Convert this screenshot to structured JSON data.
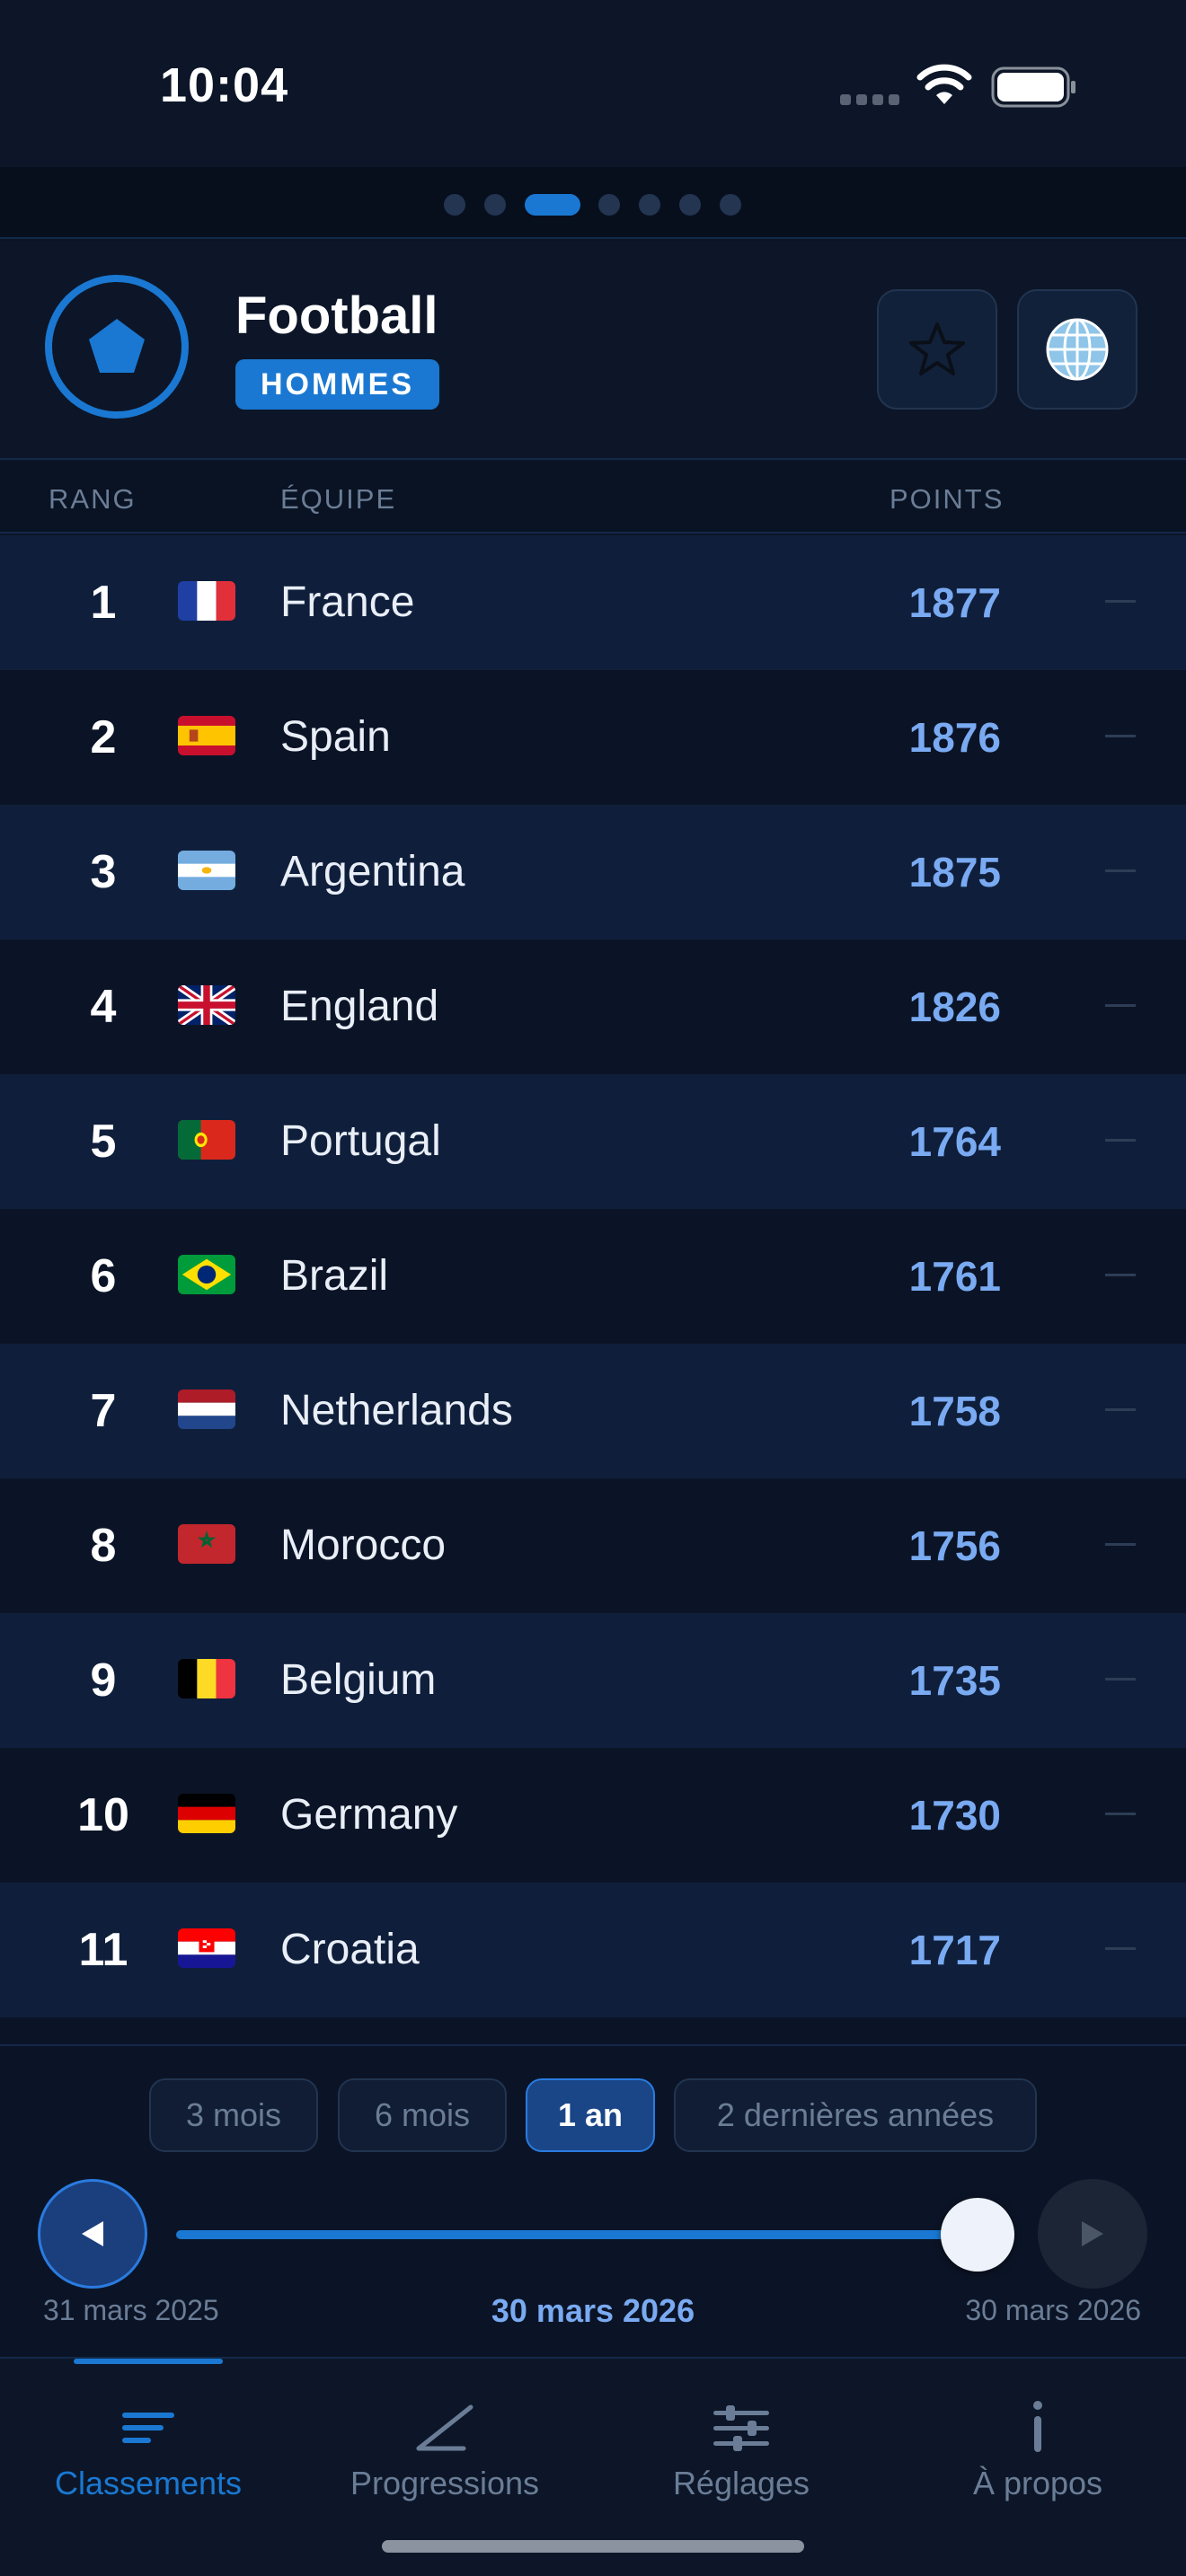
{
  "status_bar": {
    "time": "10:04"
  },
  "pager": {
    "count": 8,
    "active_index": 2
  },
  "header": {
    "sport": "Football",
    "gender": "HOMMES",
    "favorite_icon": "star-outline-icon",
    "language_icon": "globe-icon",
    "badge_icon": "pentagon-icon"
  },
  "table": {
    "columns": {
      "rank": "RANG",
      "team": "ÉQUIPE",
      "points": "POINTS"
    },
    "rows": [
      {
        "rank": "1",
        "flag": "france",
        "team": "France",
        "points": "1877",
        "trend": "—"
      },
      {
        "rank": "2",
        "flag": "spain",
        "team": "Spain",
        "points": "1876",
        "trend": "—"
      },
      {
        "rank": "3",
        "flag": "argentina",
        "team": "Argentina",
        "points": "1875",
        "trend": "—"
      },
      {
        "rank": "4",
        "flag": "england",
        "team": "England",
        "points": "1826",
        "trend": "—"
      },
      {
        "rank": "5",
        "flag": "portugal",
        "team": "Portugal",
        "points": "1764",
        "trend": "—"
      },
      {
        "rank": "6",
        "flag": "brazil",
        "team": "Brazil",
        "points": "1761",
        "trend": "—"
      },
      {
        "rank": "7",
        "flag": "netherlands",
        "team": "Netherlands",
        "points": "1758",
        "trend": "—"
      },
      {
        "rank": "8",
        "flag": "morocco",
        "team": "Morocco",
        "points": "1756",
        "trend": "—"
      },
      {
        "rank": "9",
        "flag": "belgium",
        "team": "Belgium",
        "points": "1735",
        "trend": "—"
      },
      {
        "rank": "10",
        "flag": "germany",
        "team": "Germany",
        "points": "1730",
        "trend": "—"
      },
      {
        "rank": "11",
        "flag": "croatia",
        "team": "Croatia",
        "points": "1717",
        "trend": "—"
      }
    ]
  },
  "range": {
    "options": [
      "3 mois",
      "6 mois",
      "1 an",
      "2 dernières années"
    ],
    "selected": "1 an"
  },
  "timeline": {
    "start": "31 mars 2025",
    "current": "30 mars 2026",
    "end": "30 mars 2026",
    "position": 1.0,
    "prev_icon": "triangle-left-icon",
    "next_icon": "triangle-right-icon"
  },
  "tabs": [
    {
      "label": "Classements",
      "icon": "list-icon",
      "active": true
    },
    {
      "label": "Progressions",
      "icon": "trend-line-icon",
      "active": false
    },
    {
      "label": "Réglages",
      "icon": "sliders-icon",
      "active": false
    },
    {
      "label": "À propos",
      "icon": "info-icon",
      "active": false
    }
  ],
  "colors": {
    "accent": "#1a78d2",
    "points": "#79aaf2",
    "background": "#0b1426",
    "row_alt": "#0f1f3b",
    "muted": "#6b7d96"
  }
}
